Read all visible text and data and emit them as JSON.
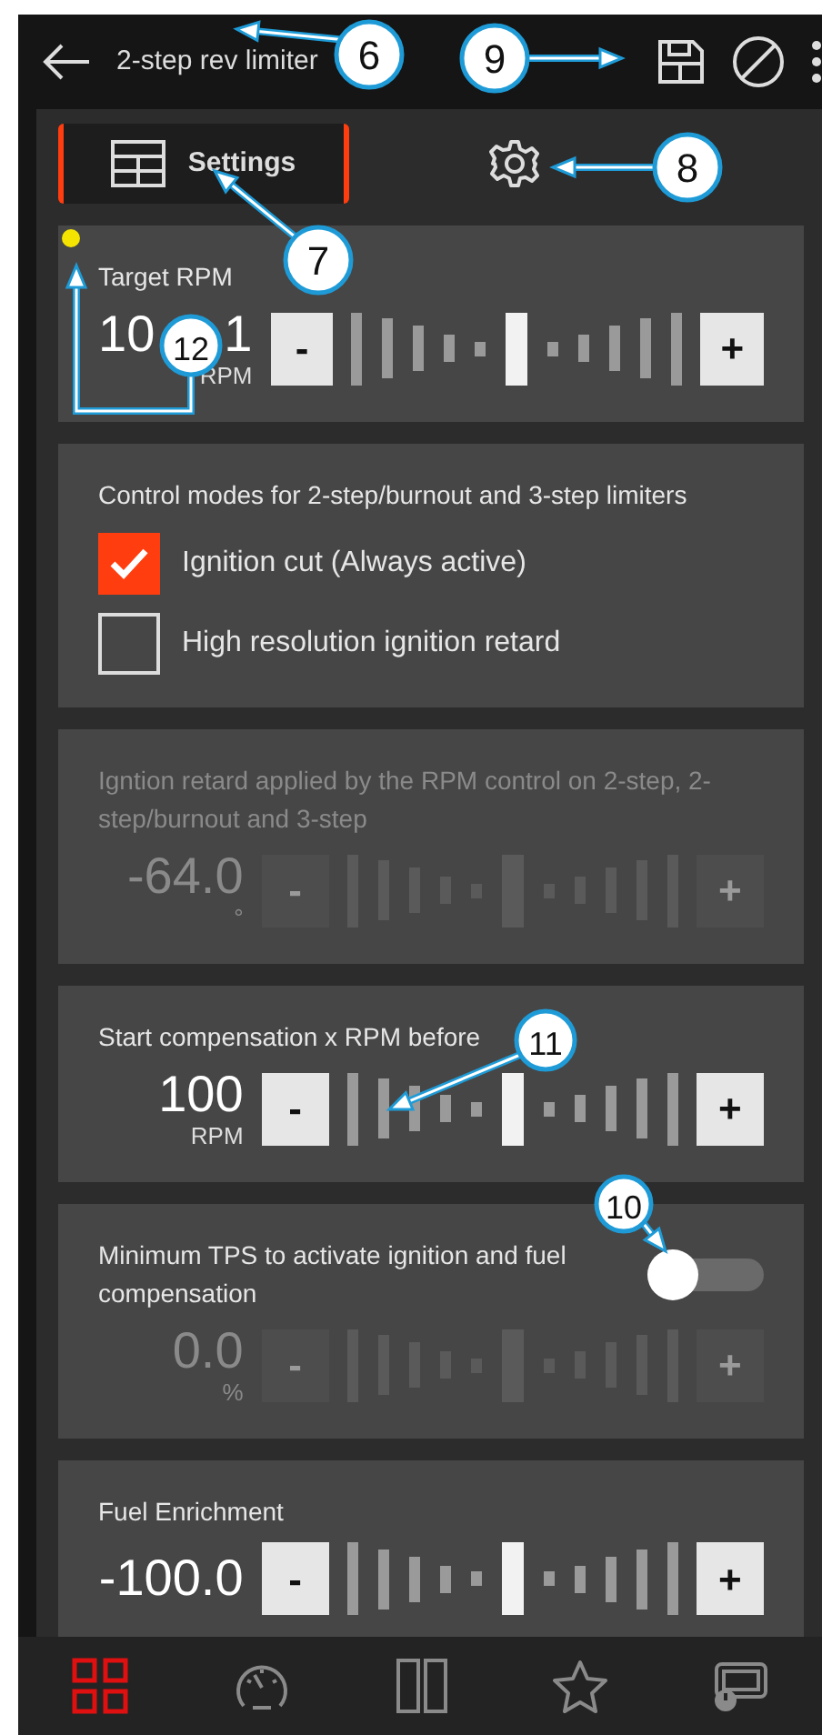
{
  "header": {
    "title": "2-step rev limiter"
  },
  "tabs": [
    {
      "kind": "label",
      "label": "Settings",
      "selected": true
    },
    {
      "kind": "gear",
      "selected": false
    }
  ],
  "cards": [
    {
      "kind": "stepper",
      "label": "Target RPM",
      "modified": true,
      "value": [
        "10",
        "1"
      ],
      "unit": "RPM",
      "decrement": "-",
      "increment": "+",
      "disabled": false
    },
    {
      "kind": "checkboxes",
      "label": "Control modes for 2-step/burnout and 3-step limiters",
      "options": [
        {
          "label": "Ignition cut (Always active)",
          "checked": true
        },
        {
          "label": "High resolution ignition retard",
          "checked": false
        }
      ]
    },
    {
      "kind": "stepper",
      "label": "Igntion retard applied by the RPM control on 2-step, 2-step/burnout and 3-step",
      "modified": false,
      "value": "-64.0",
      "unit": "°",
      "decrement": "-",
      "increment": "+",
      "disabled": true
    },
    {
      "kind": "stepper",
      "label": "Start compensation x RPM before",
      "modified": false,
      "value": "100",
      "unit": "RPM",
      "decrement": "-",
      "increment": "+",
      "disabled": false
    },
    {
      "kind": "toggle",
      "label": "Minimum TPS to activate ignition and fuel compensation",
      "on": false,
      "value": "0.0",
      "unit": "%",
      "decrement": "-",
      "increment": "+",
      "disabled": true
    },
    {
      "kind": "stepper",
      "label": "Fuel Enrichment",
      "modified": false,
      "value": "-100.0",
      "decrement": "-",
      "increment": "+",
      "disabled": false
    }
  ],
  "nav": [
    {
      "kind": "grid",
      "selected": true
    },
    {
      "kind": "gauge",
      "selected": false
    },
    {
      "kind": "columns",
      "selected": false
    },
    {
      "kind": "star",
      "selected": false
    },
    {
      "kind": "screen",
      "selected": false
    }
  ],
  "callouts": [
    {
      "number": "6"
    },
    {
      "number": "9"
    },
    {
      "number": "8"
    },
    {
      "number": "7"
    },
    {
      "number": "12"
    },
    {
      "number": "11"
    },
    {
      "number": "10"
    }
  ]
}
